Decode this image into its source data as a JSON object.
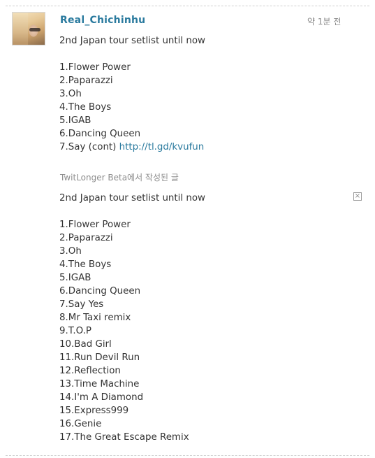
{
  "tweet": {
    "username": "Real_Chichinhu",
    "timestamp": "약 1분 전",
    "intro": "2nd Japan tour setlist until now",
    "lines": [
      "1.Flower Power",
      "2.Paparazzi",
      "3.Oh",
      "4.The Boys",
      "5.IGAB",
      "6.Dancing Queen"
    ],
    "last_line_prefix": "7.Say (cont) ",
    "link": "http://tl.gd/kvufun"
  },
  "source_label": "TwitLonger Beta에서 작성된 글",
  "longer": {
    "intro": "2nd Japan tour setlist until now",
    "lines": [
      "1.Flower Power",
      "2.Paparazzi",
      "3.Oh",
      "4.The Boys",
      "5.IGAB",
      "6.Dancing Queen",
      "7.Say Yes",
      "8.Mr Taxi remix",
      "9.T.O.P",
      "10.Bad Girl",
      "11.Run Devil Run",
      "12.Reflection",
      "13.Time Machine",
      "14.I'm A Diamond",
      "15.Express999",
      "16.Genie",
      "17.The Great Escape Remix"
    ]
  },
  "icons": {
    "close": "close-x-icon"
  },
  "colors": {
    "username": "#2a7a9e",
    "link": "#2a7a9e",
    "text": "#333333",
    "muted": "#8d8d8d"
  }
}
